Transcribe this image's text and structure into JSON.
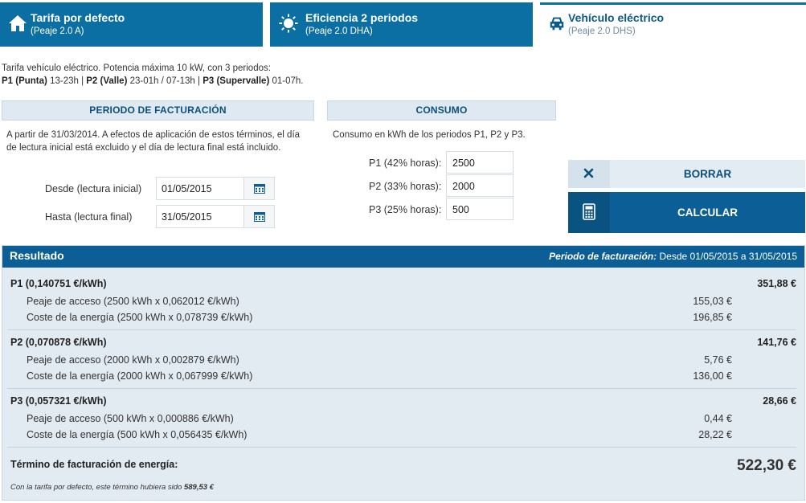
{
  "tabs": [
    {
      "title": "Tarifa por defecto",
      "subtitle": "(Peaje 2.0 A)",
      "icon": "home-icon"
    },
    {
      "title": "Eficiencia 2 periodos",
      "subtitle": "(Peaje 2.0 DHA)",
      "icon": "sun-icon"
    },
    {
      "title": "Vehículo eléctrico",
      "subtitle": "(Peaje 2.0 DHS)",
      "icon": "car-icon"
    }
  ],
  "intro": {
    "line1": "Tarifa vehículo eléctrico. Potencia máxima 10 kW, con 3 periodos:",
    "p1_label": "P1 (Punta)",
    "p1_hours": " 13-23h | ",
    "p2_label": "P2 (Valle)",
    "p2_hours": " 23-01h / 07-13h | ",
    "p3_label": "P3 (Supervalle)",
    "p3_hours": " 01-07h."
  },
  "billing": {
    "header": "PERIODO DE FACTURACIÓN",
    "note": "A partir de 31/03/2014. A efectos de aplicación de estos términos, el día de lectura inicial está excluido y el día de lectura final está incluido.",
    "from_label": "Desde (lectura inicial)",
    "from_value": "01/05/2015",
    "to_label": "Hasta (lectura final)",
    "to_value": "31/05/2015"
  },
  "consumption": {
    "header": "CONSUMO",
    "note": "Consumo en kWh de los periodos P1, P2 y P3.",
    "fields": [
      {
        "label": "P1 (42% horas):",
        "value": "2500"
      },
      {
        "label": "P2 (33% horas):",
        "value": "2000"
      },
      {
        "label": "P3 (25% horas):",
        "value": "500"
      }
    ]
  },
  "buttons": {
    "clear": "BORRAR",
    "calculate": "CALCULAR"
  },
  "result": {
    "title": "Resultado",
    "period_label": "Periodo de facturación:",
    "period_value": " Desde 01/05/2015 a 31/05/2015",
    "sections": [
      {
        "title": "P1 (0,140751 €/kWh)",
        "total": "351,88 €",
        "lines": [
          {
            "label": "Peaje de acceso (2500 kWh x 0,062012 €/kWh)",
            "amount": "155,03 €"
          },
          {
            "label": "Coste de la energía (2500 kWh x 0,078739 €/kWh)",
            "amount": "196,85 €"
          }
        ]
      },
      {
        "title": "P2 (0,070878 €/kWh)",
        "total": "141,76 €",
        "lines": [
          {
            "label": "Peaje de acceso (2000 kWh x 0,002879 €/kWh)",
            "amount": "5,76 €"
          },
          {
            "label": "Coste de la energía (2000 kWh x 0,067999 €/kWh)",
            "amount": "136,00 €"
          }
        ]
      },
      {
        "title": "P3 (0,057321 €/kWh)",
        "total": "28,66 €",
        "lines": [
          {
            "label": "Peaje de acceso (500 kWh x 0,000886 €/kWh)",
            "amount": "0,44 €"
          },
          {
            "label": "Coste de la energía (500 kWh x 0,056435 €/kWh)",
            "amount": "28,22 €"
          }
        ]
      }
    ],
    "final_label": "Término de facturación de energía:",
    "final_amount": "522,30 €",
    "footnote_text": "Con la tarifa por defecto, este término hubiera sido ",
    "footnote_amount": "589,53 €"
  },
  "colors": {
    "primary": "#0b6fa4",
    "dark": "#0b5f96",
    "panel": "#e2eaf2"
  }
}
